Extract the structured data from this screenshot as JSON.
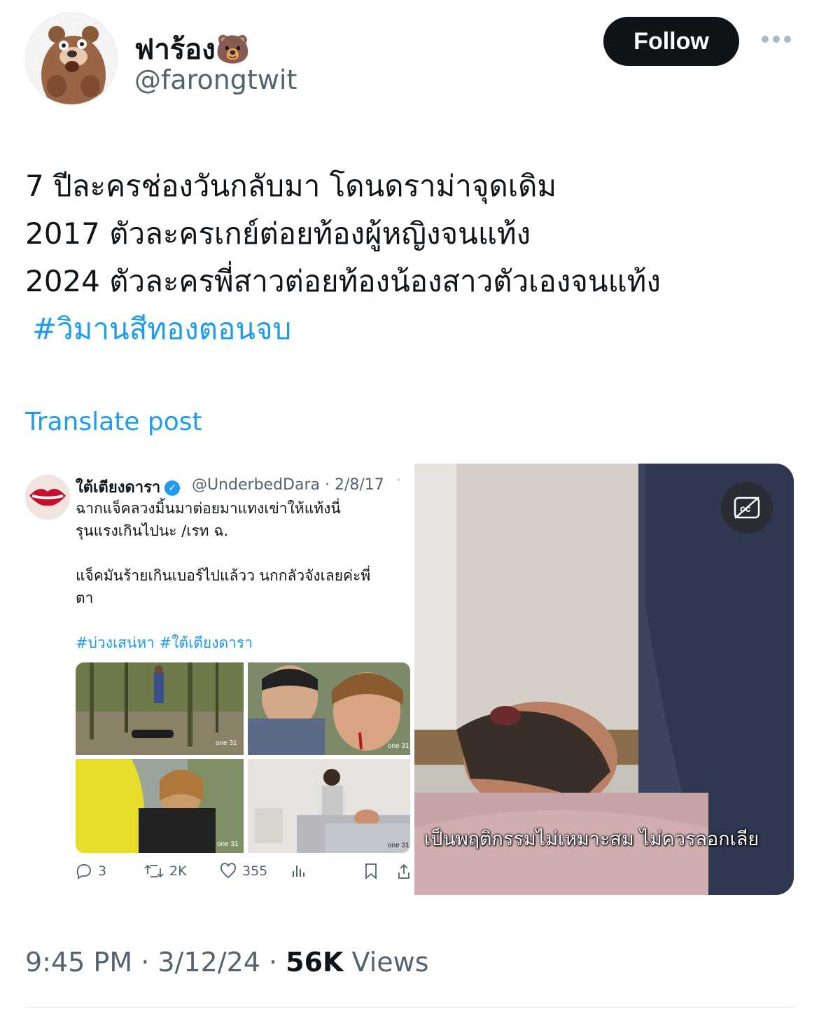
{
  "author": {
    "display_name": "ฟาร้อง🐻",
    "handle": "@farongtwit",
    "avatar_icon": "bear-avatar-icon"
  },
  "header": {
    "follow_label": "Follow",
    "more_icon": "more-dots-icon"
  },
  "tweet": {
    "lines": [
      "7 ปีละครช่องวันกลับมา โดนดราม่าจุดเดิม",
      "2017 ตัวละครเกย์ต่อยท้องผู้หญิงจนแท้ง",
      "2024 ตัวละครพี่สาวต่อยท้องน้องสาวตัวเองจนแท้ง"
    ],
    "hashtag": "#วิมานสีทองตอนจบ",
    "translate_label": "Translate post"
  },
  "quoted_screenshot": {
    "name": "ใต้เตียงดารา",
    "handle_date": "@UnderbedDara · 2/8/17",
    "text_lines": [
      "ฉากแจ็คลวงมิ้นมาต่อยมาแทงเข่าให้แท้งนี่",
      "รุนแรงเกินไปนะ /เรท ฉ.",
      "",
      "แจ็คมันร้ายเกินเบอร์ไปแล้วว นกกลัวจังเลยค่ะพี่",
      "ตา"
    ],
    "hashtags": "#บ่วงเสน่หา #ใต้เตียงดารา",
    "watermark": "one 31",
    "actions": {
      "replies": "3",
      "retweets": "2K",
      "likes": "355"
    }
  },
  "video": {
    "subtitle": "เป็นพฤติกรรมไม่เหมาะสม ไม่ควรลอกเลีย",
    "cc_icon": "captions-off-icon"
  },
  "meta": {
    "time": "9:45 PM",
    "separator": " · ",
    "date": "3/12/24",
    "views_count": "56K",
    "views_label": " Views"
  },
  "colors": {
    "accent": "#1d9bf0",
    "text": "#0f1419",
    "muted": "#536471"
  }
}
